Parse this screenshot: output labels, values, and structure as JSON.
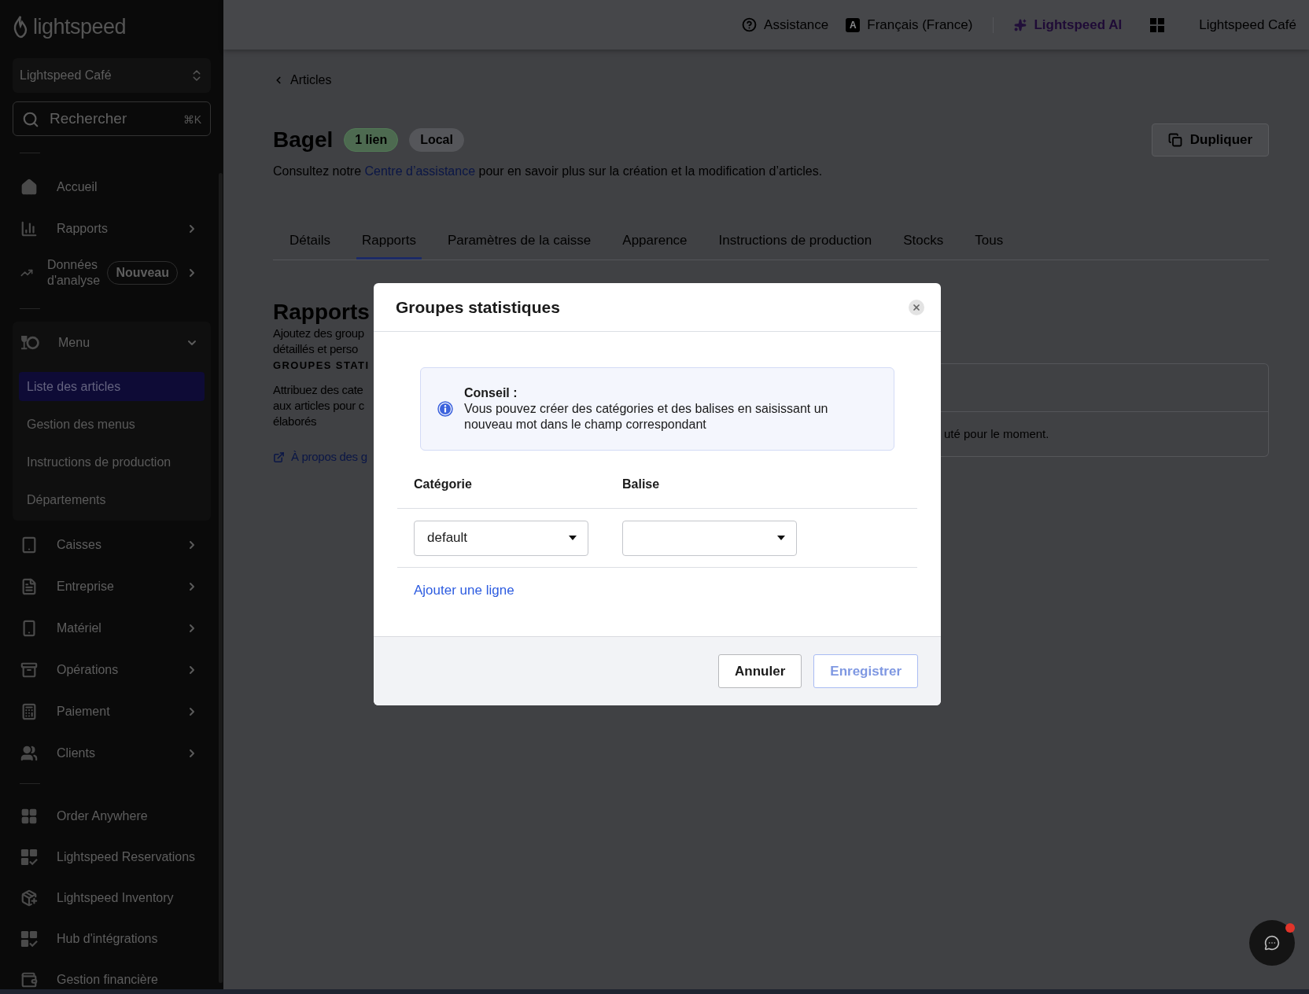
{
  "sidebar": {
    "logo": "lightspeed",
    "store_selector": {
      "label": "Lightspeed Café"
    },
    "search": {
      "placeholder": "Rechercher",
      "shortcut": "⌘K"
    },
    "groups": [
      {
        "items": [
          {
            "label": "Accueil"
          },
          {
            "label": "Rapports",
            "expanded": false
          },
          {
            "label": "Données d'analyse",
            "badge": "Nouveau",
            "expanded": false
          }
        ]
      },
      {
        "items": [
          {
            "label": "Menu",
            "expanded": true,
            "children": [
              {
                "label": "Liste des articles",
                "selected": true
              },
              {
                "label": "Gestion des menus",
                "selected": false
              },
              {
                "label": "Instructions de production",
                "selected": false
              },
              {
                "label": "Départements",
                "selected": false
              }
            ]
          },
          {
            "label": "Caisses",
            "expanded": false
          },
          {
            "label": "Entreprise",
            "expanded": false
          },
          {
            "label": "Matériel",
            "expanded": false
          },
          {
            "label": "Opérations",
            "expanded": false
          },
          {
            "label": "Paiement",
            "expanded": false
          },
          {
            "label": "Clients",
            "expanded": false
          }
        ]
      },
      {
        "items": [
          {
            "label": "Order Anywhere"
          },
          {
            "label": "Lightspeed Reservations"
          },
          {
            "label": "Lightspeed Inventory"
          },
          {
            "label": "Hub d'intégrations"
          },
          {
            "label": "Gestion financière"
          }
        ]
      }
    ]
  },
  "top_bar": {
    "links": [
      {
        "label": "Assistance",
        "kind": "help"
      },
      {
        "label": "Français (France)",
        "kind": "language",
        "icon_letter": "A"
      },
      {
        "label": "Lightspeed AI",
        "kind": "ai"
      }
    ],
    "account": "Lightspeed Café"
  },
  "page": {
    "breadcrumb": "Articles",
    "title": "Bagel",
    "badges": [
      {
        "label": "1 lien",
        "kind": "success"
      },
      {
        "label": "Local",
        "kind": "neutral"
      }
    ],
    "duplicate_button": "Dupliquer",
    "help_text": {
      "before": "Consultez notre ",
      "link": "Centre d’assistance",
      "after": " pour en savoir plus sur la création et la modification d’articles."
    },
    "tabs": [
      {
        "label": "Détails",
        "selected": false
      },
      {
        "label": "Rapports",
        "selected": true
      },
      {
        "label": "Paramètres de la caisse",
        "selected": false
      },
      {
        "label": "Apparence",
        "selected": false
      },
      {
        "label": "Instructions de production",
        "selected": false
      },
      {
        "label": "Stocks",
        "selected": false
      },
      {
        "label": "Tous",
        "selected": false
      }
    ],
    "section": {
      "title": "Rapports",
      "description": [
        "Ajoutez des group",
        "détaillés et perso"
      ],
      "subheading": "GROUPES STATI",
      "subtext": [
        "Attribuez des cate",
        "aux articles pour c",
        "élaborés"
      ],
      "link": "À propos des g"
    },
    "card": {
      "row_text": "uté pour le moment."
    }
  },
  "dialog": {
    "title": "Groupes statistiques",
    "tip": {
      "title": "Conseil :",
      "text": "Vous pouvez créer des catégories et des balises en saisissant un nouveau mot dans le champ correspondant"
    },
    "columns": [
      "Catégorie",
      "Balise"
    ],
    "rows": [
      {
        "category": "default"
      }
    ],
    "add_row_link": "Ajouter une ligne",
    "buttons": [
      {
        "label": "Annuler",
        "kind": "secondary",
        "disabled": false
      },
      {
        "label": "Enregistrer",
        "kind": "primary",
        "disabled": true
      }
    ]
  },
  "chat_button": {
    "notification": true
  }
}
